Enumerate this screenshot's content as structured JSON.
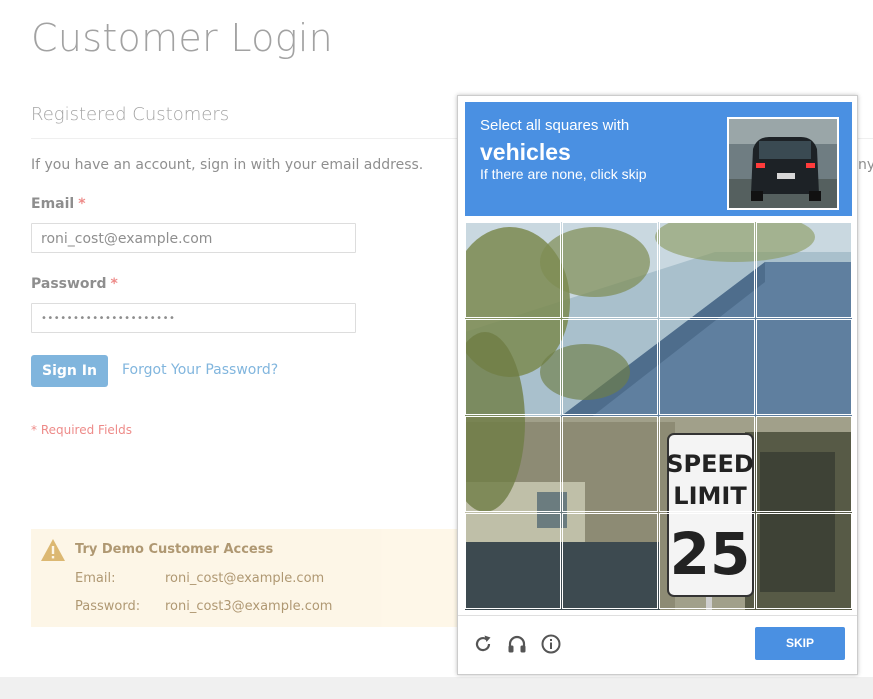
{
  "page": {
    "title": "Customer Login",
    "section_title": "Registered Customers",
    "intro": "If you have an account, sign in with your email address.",
    "intro_overflow": "ny"
  },
  "form": {
    "email_label": "Email",
    "email_value": "roni_cost@example.com",
    "password_label": "Password",
    "password_value": "•••••••••••••••••••••",
    "required_star": "*",
    "signin_label": "Sign In",
    "forgot_label": "Forgot Your Password?",
    "required_note": "* Required Fields"
  },
  "demo": {
    "title": "Try Demo Customer Access",
    "email_label": "Email:",
    "email_value": "roni_cost@example.com",
    "password_label": "Password:",
    "password_value": "roni_cost3@example.com"
  },
  "captcha": {
    "instruction": "Select all squares with",
    "target": "vehicles",
    "subtext": "If there are none, click skip",
    "skip_label": "SKIP",
    "icons": [
      "reload-icon",
      "audio-icon",
      "info-icon"
    ],
    "sign_text": [
      "SPEED",
      "LIMIT",
      "25"
    ],
    "header_color": "#4a90e2"
  },
  "colors": {
    "brand_blue": "#1979c3",
    "error_red": "#e02b27",
    "notice_bg": "#fdf0d5"
  }
}
